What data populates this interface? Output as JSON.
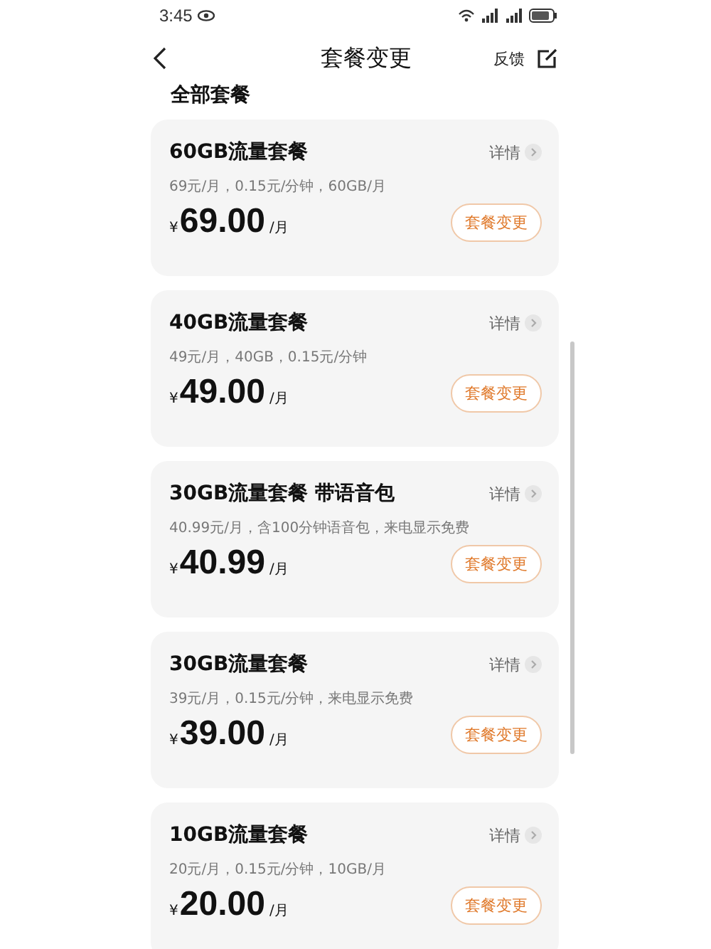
{
  "status_bar": {
    "time": "3:45"
  },
  "header": {
    "title": "套餐变更",
    "action": "反馈"
  },
  "section_title": "全部套餐",
  "plans": [
    {
      "name": "60GB流量套餐",
      "description": "69元/月，0.15元/分钟，60GB/月",
      "currency": "¥",
      "price": "69.00",
      "unit": "/月",
      "details": "详情",
      "button": "套餐变更"
    },
    {
      "name": "40GB流量套餐",
      "description": "49元/月，40GB，0.15元/分钟",
      "currency": "¥",
      "price": "49.00",
      "unit": "/月",
      "details": "详情",
      "button": "套餐变更"
    },
    {
      "name": "30GB流量套餐 带语音包",
      "description": "40.99元/月，含100分钟语音包，来电显示免费",
      "currency": "¥",
      "price": "40.99",
      "unit": "/月",
      "details": "详情",
      "button": "套餐变更"
    },
    {
      "name": "30GB流量套餐",
      "description": "39元/月，0.15元/分钟，来电显示免费",
      "currency": "¥",
      "price": "39.00",
      "unit": "/月",
      "details": "详情",
      "button": "套餐变更"
    },
    {
      "name": "10GB流量套餐",
      "description": "20元/月，0.15元/分钟，10GB/月",
      "currency": "¥",
      "price": "20.00",
      "unit": "/月",
      "details": "详情",
      "button": "套餐变更"
    }
  ]
}
